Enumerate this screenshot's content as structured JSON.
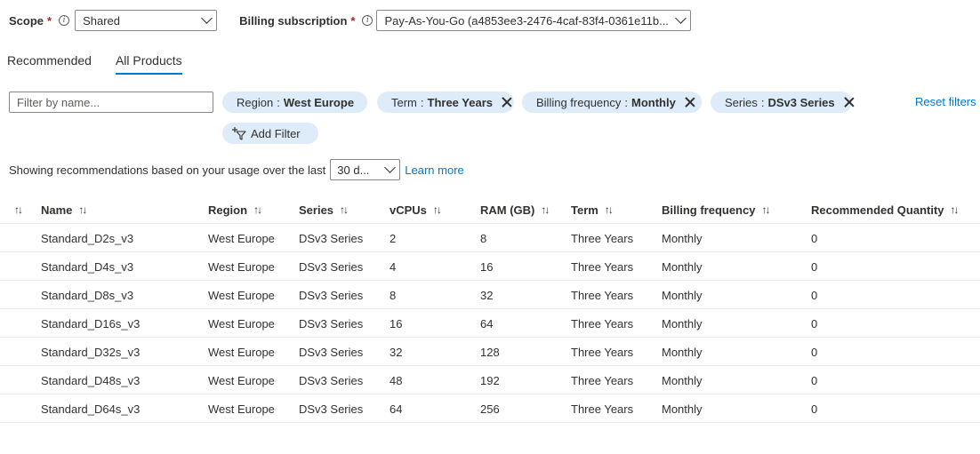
{
  "scope": {
    "label": "Scope",
    "required_mark": "*",
    "value": "Shared"
  },
  "billing": {
    "label": "Billing subscription",
    "required_mark": "*",
    "value": "Pay-As-You-Go (a4853ee3-2476-4caf-83f4-0361e11b..."
  },
  "tabs": [
    {
      "label": "Recommended",
      "active": false
    },
    {
      "label": "All Products",
      "active": true
    }
  ],
  "filter": {
    "placeholder": "Filter by name...",
    "pills": [
      {
        "key": "Region",
        "sep": ":",
        "value": "West Europe",
        "removable": false
      },
      {
        "key": "Term",
        "sep": ":",
        "value": "Three Years",
        "removable": true
      },
      {
        "key": "Billing frequency",
        "sep": ":",
        "value": "Monthly",
        "removable": true
      },
      {
        "key": "Series",
        "sep": ":",
        "value": "DSv3 Series",
        "removable": true
      }
    ],
    "reset_label": "Reset filters",
    "add_filter_label": "Add Filter"
  },
  "usage": {
    "text": "Showing recommendations based on your usage over the last",
    "period_value": "30 d...",
    "learn_more": "Learn more"
  },
  "table": {
    "sort_glyph": "↑↓",
    "columns": [
      "Name",
      "Region",
      "Series",
      "vCPUs",
      "RAM (GB)",
      "Term",
      "Billing frequency",
      "Recommended Quantity"
    ],
    "rows": [
      [
        "Standard_D2s_v3",
        "West Europe",
        "DSv3 Series",
        "2",
        "8",
        "Three Years",
        "Monthly",
        "0"
      ],
      [
        "Standard_D4s_v3",
        "West Europe",
        "DSv3 Series",
        "4",
        "16",
        "Three Years",
        "Monthly",
        "0"
      ],
      [
        "Standard_D8s_v3",
        "West Europe",
        "DSv3 Series",
        "8",
        "32",
        "Three Years",
        "Monthly",
        "0"
      ],
      [
        "Standard_D16s_v3",
        "West Europe",
        "DSv3 Series",
        "16",
        "64",
        "Three Years",
        "Monthly",
        "0"
      ],
      [
        "Standard_D32s_v3",
        "West Europe",
        "DSv3 Series",
        "32",
        "128",
        "Three Years",
        "Monthly",
        "0"
      ],
      [
        "Standard_D48s_v3",
        "West Europe",
        "DSv3 Series",
        "48",
        "192",
        "Three Years",
        "Monthly",
        "0"
      ],
      [
        "Standard_D64s_v3",
        "West Europe",
        "DSv3 Series",
        "64",
        "256",
        "Three Years",
        "Monthly",
        "0"
      ]
    ]
  },
  "colors": {
    "accent": "#0078d4",
    "pill_bg": "#deecf9",
    "required": "#a4262c",
    "divider": "#edebe9"
  }
}
